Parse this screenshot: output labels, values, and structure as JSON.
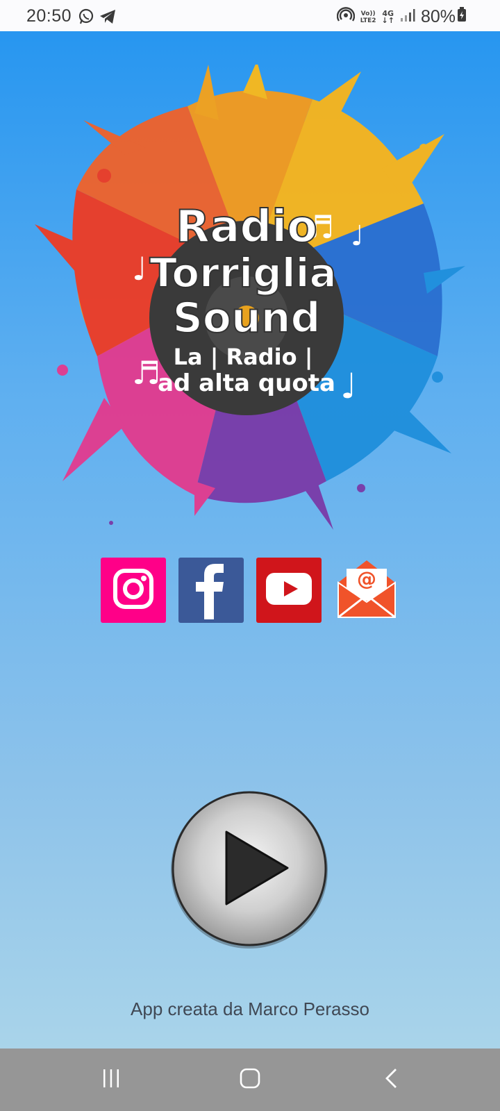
{
  "status_bar": {
    "time": "20:50",
    "notification_icons": [
      "whatsapp-icon",
      "telegram-icon"
    ],
    "system_icons": [
      "hotspot-icon",
      "volte-icon",
      "4g-icon",
      "signal-icon"
    ],
    "volte_label_top": "Vo))",
    "volte_label_bottom": "LTE2",
    "network_label": "4G",
    "battery": "80%"
  },
  "logo": {
    "line1": "Radio",
    "line2": "Torriglia",
    "line3": "Sound",
    "tagline1": "La | Radio |",
    "tagline2": "ad alta quota"
  },
  "social_links": [
    {
      "name": "instagram",
      "icon": "instagram-icon",
      "color": "#ff0088"
    },
    {
      "name": "facebook",
      "icon": "facebook-icon",
      "color": "#3b5998"
    },
    {
      "name": "youtube",
      "icon": "youtube-icon",
      "color": "#d0151b"
    },
    {
      "name": "email",
      "icon": "email-icon",
      "color": "#f0532a"
    }
  ],
  "player": {
    "icon": "play-icon"
  },
  "footer": {
    "credit": "App creata da Marco Perasso"
  },
  "nav_bar": {
    "buttons": [
      "recents-icon",
      "home-icon",
      "back-icon"
    ]
  },
  "colors": {
    "background_top": "#2796f0",
    "background_bottom": "#a9d4ea",
    "nav_bar": "#969696"
  }
}
